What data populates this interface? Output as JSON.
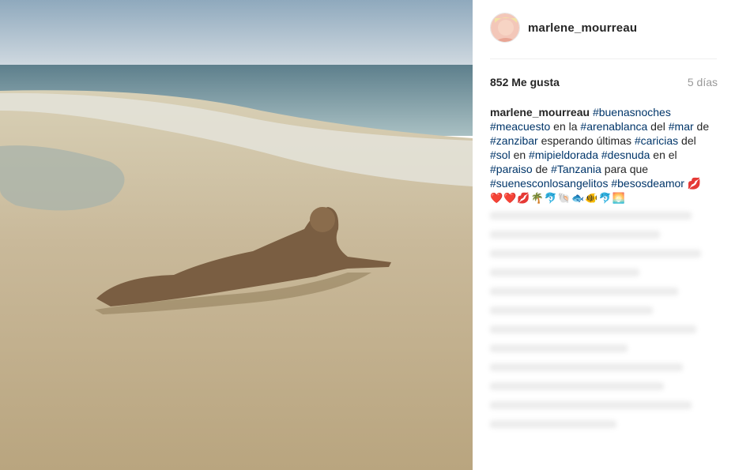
{
  "post": {
    "username": "marlene_mourreau",
    "likes": "852 Me gusta",
    "time": "5 días",
    "caption": [
      {
        "text": "marlene_mourreau",
        "type": "user"
      },
      {
        "text": " ",
        "type": "text"
      },
      {
        "text": "#buenasnoches",
        "type": "tag"
      },
      {
        "text": " ",
        "type": "text"
      },
      {
        "text": "#meacuesto",
        "type": "tag"
      },
      {
        "text": " en la ",
        "type": "text"
      },
      {
        "text": "#arenablanca",
        "type": "tag"
      },
      {
        "text": " del ",
        "type": "text"
      },
      {
        "text": "#mar",
        "type": "tag"
      },
      {
        "text": " de ",
        "type": "text"
      },
      {
        "text": "#zanzibar",
        "type": "tag"
      },
      {
        "text": " esperando últimas ",
        "type": "text"
      },
      {
        "text": "#caricias",
        "type": "tag"
      },
      {
        "text": " del ",
        "type": "text"
      },
      {
        "text": "#sol",
        "type": "tag"
      },
      {
        "text": " en ",
        "type": "text"
      },
      {
        "text": "#mipieldorada",
        "type": "tag"
      },
      {
        "text": " ",
        "type": "text"
      },
      {
        "text": "#desnuda",
        "type": "tag"
      },
      {
        "text": " en el ",
        "type": "text"
      },
      {
        "text": "#paraiso",
        "type": "tag"
      },
      {
        "text": " de ",
        "type": "text"
      },
      {
        "text": "#Tanzania",
        "type": "tag"
      },
      {
        "text": " para que ",
        "type": "text"
      },
      {
        "text": "#suenesconlosangelitos",
        "type": "tag"
      },
      {
        "text": " ",
        "type": "text"
      },
      {
        "text": "#besosdeamor",
        "type": "tag"
      },
      {
        "text": " 💋",
        "type": "text"
      }
    ],
    "emoji_line": "❤️❤️💋🌴🐬🐚🐟🐠🐬🌅"
  },
  "colors": {
    "hashtag": "#003569",
    "text": "#262626",
    "muted": "#999999",
    "divider": "#efefef"
  },
  "icons": [
    "avatar-photo",
    "beach-photo"
  ]
}
